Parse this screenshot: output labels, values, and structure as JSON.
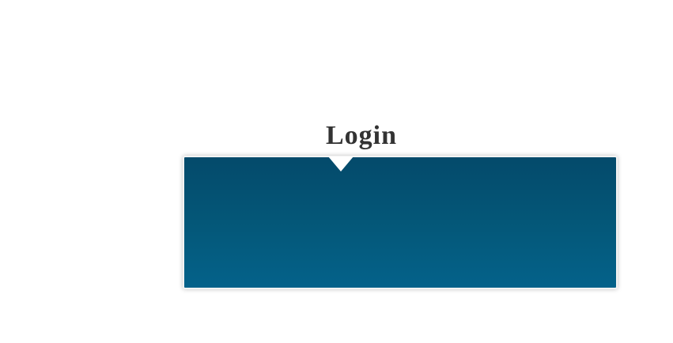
{
  "login": {
    "title": "Login"
  },
  "colors": {
    "panel_top": "#044a6b",
    "panel_bottom": "#04628a",
    "title_text": "#333333",
    "background": "#ffffff"
  }
}
